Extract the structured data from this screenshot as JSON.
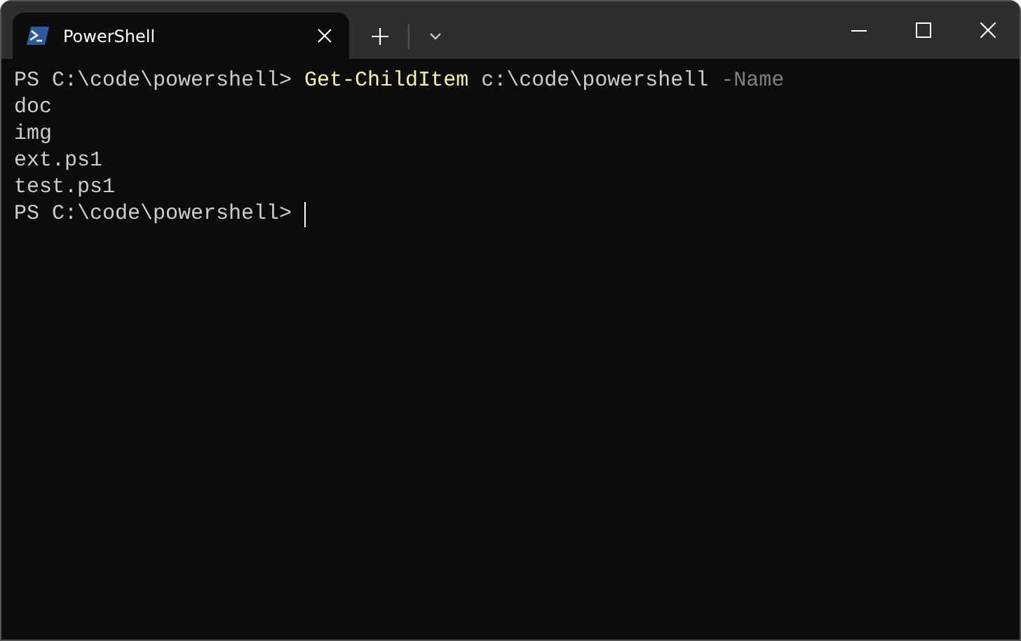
{
  "tabs": [
    {
      "title": "PowerShell",
      "selected": true
    }
  ],
  "terminal": {
    "lines": [
      {
        "segments": [
          {
            "kind": "prompt",
            "text": "PS C:\\code\\powershell>"
          },
          {
            "kind": "command",
            "text": "Get-ChildItem"
          },
          {
            "kind": "argument",
            "text": "c:\\code\\powershell"
          },
          {
            "kind": "parameter",
            "text": "-Name"
          }
        ]
      },
      {
        "segments": [
          {
            "kind": "output",
            "text": "doc"
          }
        ]
      },
      {
        "segments": [
          {
            "kind": "output",
            "text": "img"
          }
        ]
      },
      {
        "segments": [
          {
            "kind": "output",
            "text": "ext.ps1"
          }
        ]
      },
      {
        "segments": [
          {
            "kind": "output",
            "text": "test.ps1"
          }
        ]
      },
      {
        "segments": [
          {
            "kind": "prompt",
            "text": "PS C:\\code\\powershell>"
          }
        ],
        "cursor": true
      }
    ]
  }
}
